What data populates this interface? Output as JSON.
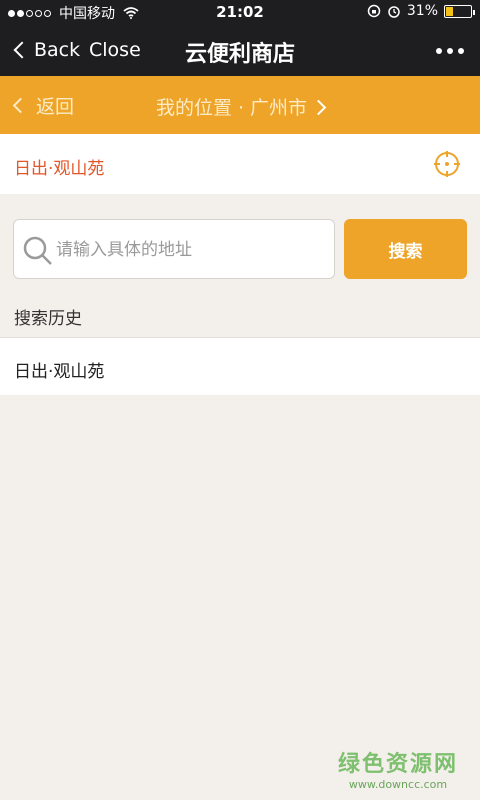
{
  "status": {
    "carrier": "中国移动",
    "time": "21:02",
    "battery": "31%",
    "battery_level": 0.31
  },
  "nav": {
    "back_label": "Back",
    "close_label": "Close",
    "title": "云便利商店"
  },
  "locbar": {
    "back_label": "返回",
    "location_label": "我的位置 · 广州市"
  },
  "current": {
    "name": "日出·观山苑"
  },
  "search": {
    "placeholder": "请输入具体的地址",
    "value": "",
    "button_label": "搜索"
  },
  "history": {
    "title": "搜索历史",
    "items": [
      "日出·观山苑"
    ]
  },
  "watermark": {
    "name": "绿色资源网",
    "url": "www.downcc.com"
  },
  "colors": {
    "accent": "#eda428",
    "header": "#1e1e21",
    "location_text": "#e0572a",
    "background": "#f3efea"
  }
}
